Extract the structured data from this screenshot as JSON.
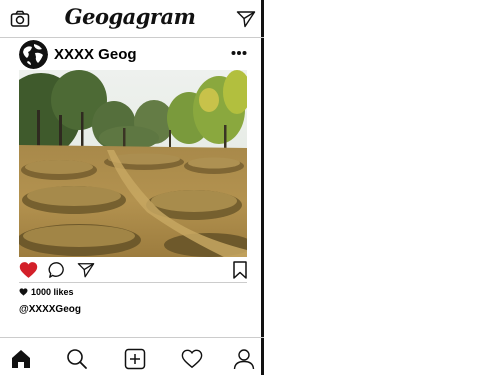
{
  "app": {
    "logo": "Geogagram"
  },
  "post": {
    "username": "XXXX Geog",
    "likes": "1000 likes",
    "caption": "@XXXXGeog",
    "liked": true
  },
  "colors": {
    "heart_liked": "#d3202a",
    "text": "#111111",
    "divider": "#cccccc"
  },
  "icons": {
    "top_left": "camera-icon",
    "top_right": "send-icon",
    "actions": [
      "heart-icon",
      "comment-icon",
      "share-icon",
      "bookmark-icon"
    ],
    "nav": [
      "home-icon",
      "search-icon",
      "add-post-icon",
      "activity-icon",
      "profile-icon"
    ]
  }
}
